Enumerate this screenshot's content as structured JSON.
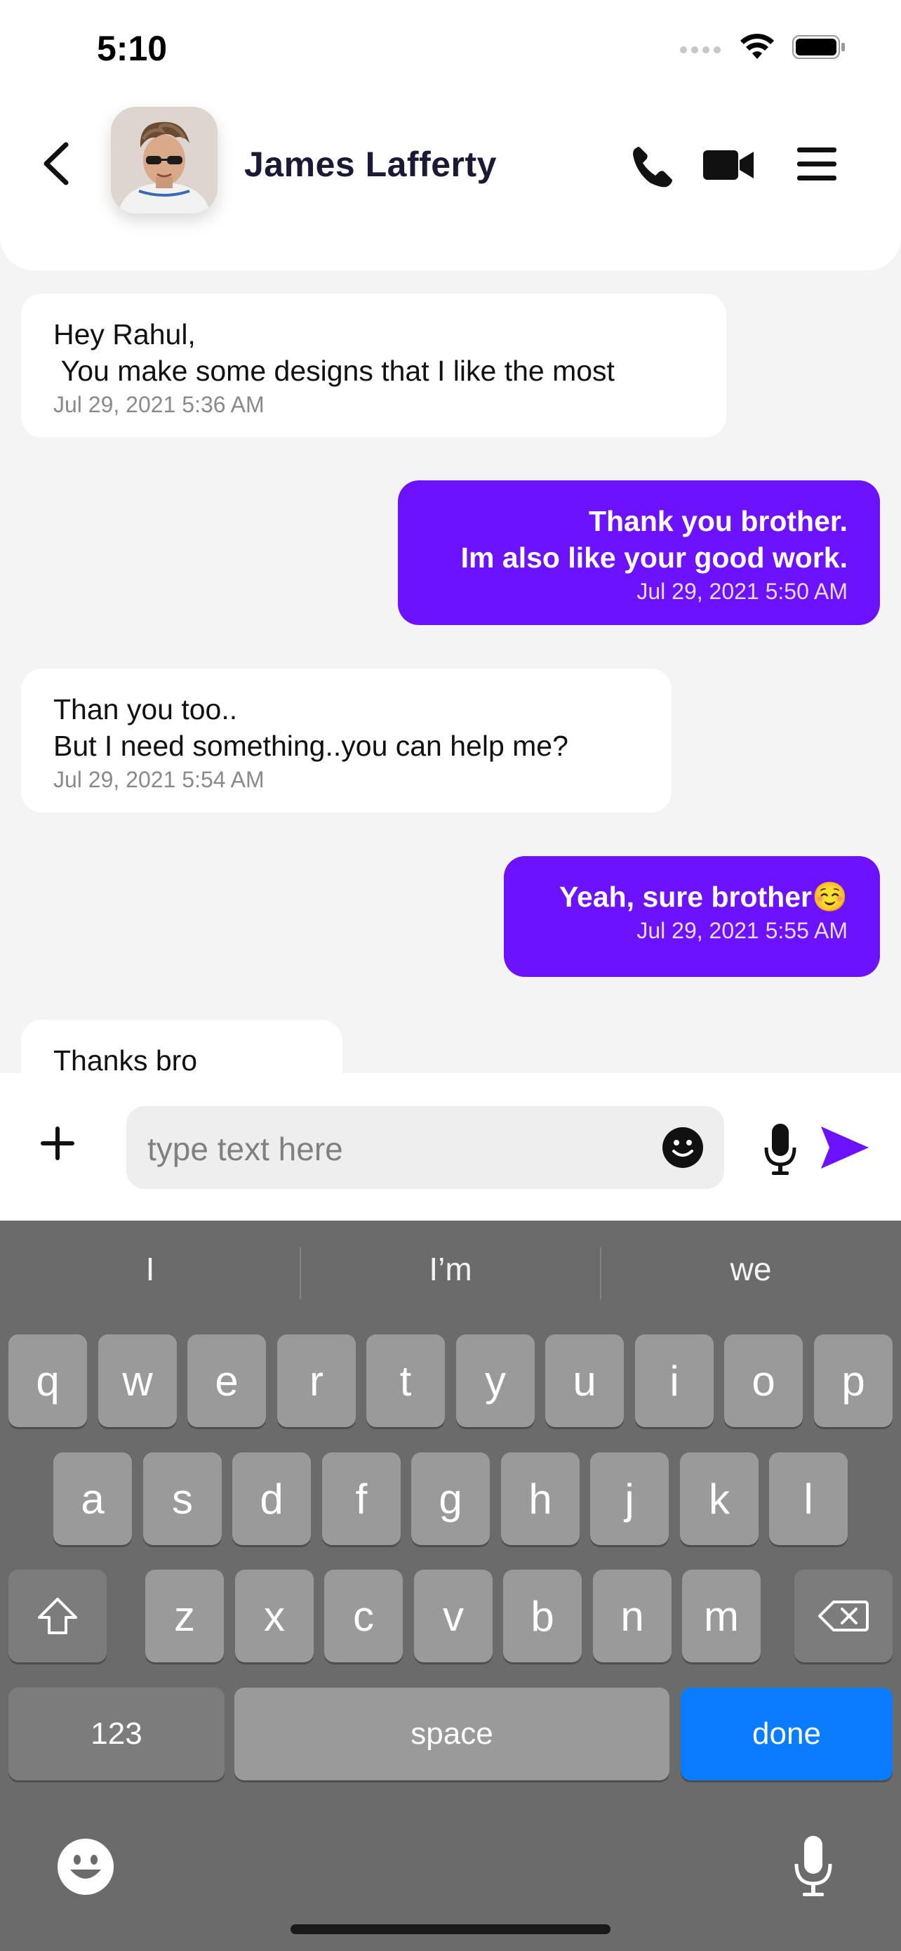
{
  "status_bar": {
    "time": "5:10"
  },
  "header": {
    "contact_name": "James Lafferty",
    "icons": [
      "back-chevron-icon",
      "avatar-photo",
      "phone-icon",
      "video-camera-icon",
      "menu-icon"
    ]
  },
  "messages": [
    {
      "direction": "incoming",
      "text": "Hey Rahul,\n You make some designs that I like the most",
      "time": "Jul 29, 2021  5:36 AM"
    },
    {
      "direction": "outgoing",
      "text": "Thank you brother.\nIm also like your good work.",
      "time": "Jul 29, 2021  5:50 AM"
    },
    {
      "direction": "incoming",
      "text": "Than you too..\nBut I need something..you can help me?",
      "time": "Jul 29, 2021  5:54 AM"
    },
    {
      "direction": "outgoing",
      "text": "Yeah, sure brother☺️",
      "time": "Jul 29, 2021  5:55 AM"
    },
    {
      "direction": "incoming",
      "text": "Thanks bro",
      "time": ""
    }
  ],
  "composer": {
    "placeholder": "type text here",
    "icons": [
      "plus-icon",
      "emoji-icon",
      "microphone-icon",
      "send-icon"
    ]
  },
  "keyboard": {
    "suggestions": [
      "I",
      "I’m",
      "we"
    ],
    "row1": [
      "q",
      "w",
      "e",
      "r",
      "t",
      "y",
      "u",
      "i",
      "o",
      "p"
    ],
    "row2": [
      "a",
      "s",
      "d",
      "f",
      "g",
      "h",
      "j",
      "k",
      "l"
    ],
    "row3": [
      "z",
      "x",
      "c",
      "v",
      "b",
      "n",
      "m"
    ],
    "numbers_label": "123",
    "space_label": "space",
    "done_label": "done"
  },
  "colors": {
    "accent": "#6d12ff",
    "background": "#f4f4f4",
    "keyboard_bg": "#6b6b6b",
    "done_key": "#0a7cff"
  }
}
